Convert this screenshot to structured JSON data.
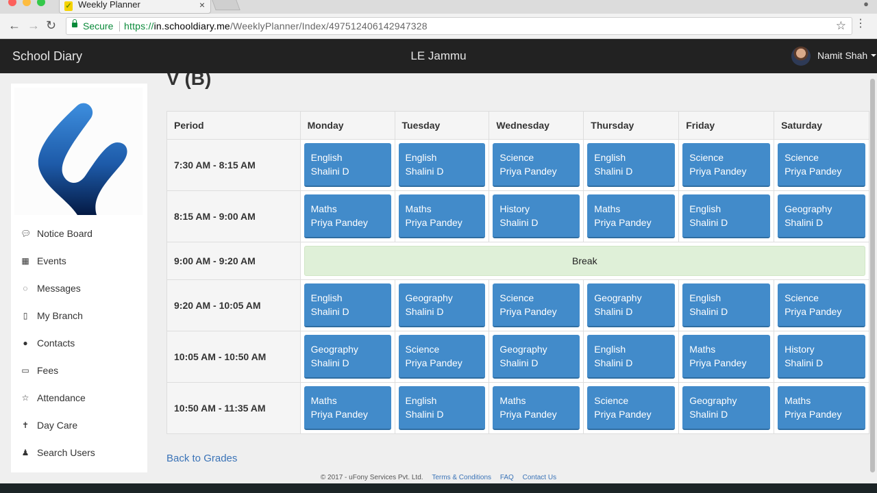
{
  "browser": {
    "tab_title": "Weekly Planner",
    "secure_label": "Secure",
    "url_scheme": "https://",
    "url_host": "in.schooldiary.me",
    "url_path": "/WeeklyPlanner/Index/497512406142947328"
  },
  "header": {
    "brand": "School Diary",
    "center_title": "LE Jammu",
    "user_name": "Namit Shah"
  },
  "sidebar": {
    "items": [
      {
        "label": "Notice Board",
        "icon": "comment-icon"
      },
      {
        "label": "Events",
        "icon": "calendar-icon"
      },
      {
        "label": "Messages",
        "icon": "comments-icon"
      },
      {
        "label": "My Branch",
        "icon": "building-icon"
      },
      {
        "label": "Contacts",
        "icon": "users-icon"
      },
      {
        "label": "Fees",
        "icon": "money-icon"
      },
      {
        "label": "Attendance",
        "icon": "star-icon"
      },
      {
        "label": "Day Care",
        "icon": "child-icon"
      },
      {
        "label": "Search Users",
        "icon": "user-secret-icon"
      }
    ]
  },
  "page": {
    "heading": "V (B)",
    "back_link": "Back to Grades"
  },
  "planner": {
    "period_header": "Period",
    "days": [
      "Monday",
      "Tuesday",
      "Wednesday",
      "Thursday",
      "Friday",
      "Saturday"
    ],
    "rows": [
      {
        "time": "7:30 AM - 8:15 AM",
        "slots": [
          {
            "subject": "English",
            "teacher": "Shalini D"
          },
          {
            "subject": "English",
            "teacher": "Shalini D"
          },
          {
            "subject": "Science",
            "teacher": "Priya Pandey"
          },
          {
            "subject": "English",
            "teacher": "Shalini D"
          },
          {
            "subject": "Science",
            "teacher": "Priya Pandey"
          },
          {
            "subject": "Science",
            "teacher": "Priya Pandey"
          }
        ]
      },
      {
        "time": "8:15 AM - 9:00 AM",
        "slots": [
          {
            "subject": "Maths",
            "teacher": "Priya Pandey"
          },
          {
            "subject": "Maths",
            "teacher": "Priya Pandey"
          },
          {
            "subject": "History",
            "teacher": "Shalini D"
          },
          {
            "subject": "Maths",
            "teacher": "Priya Pandey"
          },
          {
            "subject": "English",
            "teacher": "Shalini D"
          },
          {
            "subject": "Geography",
            "teacher": "Shalini D"
          }
        ]
      },
      {
        "time": "9:00 AM - 9:20 AM",
        "break_label": "Break"
      },
      {
        "time": "9:20 AM - 10:05 AM",
        "slots": [
          {
            "subject": "English",
            "teacher": "Shalini D"
          },
          {
            "subject": "Geography",
            "teacher": "Shalini D"
          },
          {
            "subject": "Science",
            "teacher": "Priya Pandey"
          },
          {
            "subject": "Geography",
            "teacher": "Shalini D"
          },
          {
            "subject": "English",
            "teacher": "Shalini D"
          },
          {
            "subject": "Science",
            "teacher": "Priya Pandey"
          }
        ]
      },
      {
        "time": "10:05 AM - 10:50 AM",
        "slots": [
          {
            "subject": "Geography",
            "teacher": "Shalini D"
          },
          {
            "subject": "Science",
            "teacher": "Priya Pandey"
          },
          {
            "subject": "Geography",
            "teacher": "Shalini D"
          },
          {
            "subject": "English",
            "teacher": "Shalini D"
          },
          {
            "subject": "Maths",
            "teacher": "Priya Pandey"
          },
          {
            "subject": "History",
            "teacher": "Shalini D"
          }
        ]
      },
      {
        "time": "10:50 AM - 11:35 AM",
        "slots": [
          {
            "subject": "Maths",
            "teacher": "Priya Pandey"
          },
          {
            "subject": "English",
            "teacher": "Shalini D"
          },
          {
            "subject": "Maths",
            "teacher": "Priya Pandey"
          },
          {
            "subject": "Science",
            "teacher": "Priya Pandey"
          },
          {
            "subject": "Geography",
            "teacher": "Shalini D"
          },
          {
            "subject": "Maths",
            "teacher": "Priya Pandey"
          }
        ]
      }
    ]
  },
  "footer": {
    "copyright": "© 2017 - uFony Services Pvt. Ltd.",
    "links": [
      "Terms & Conditions",
      "FAQ",
      "Contact Us"
    ]
  },
  "colors": {
    "slot_blue": "#428bca",
    "break_green": "#dff0d8",
    "navbar": "#222222",
    "link": "#3a73b7"
  }
}
